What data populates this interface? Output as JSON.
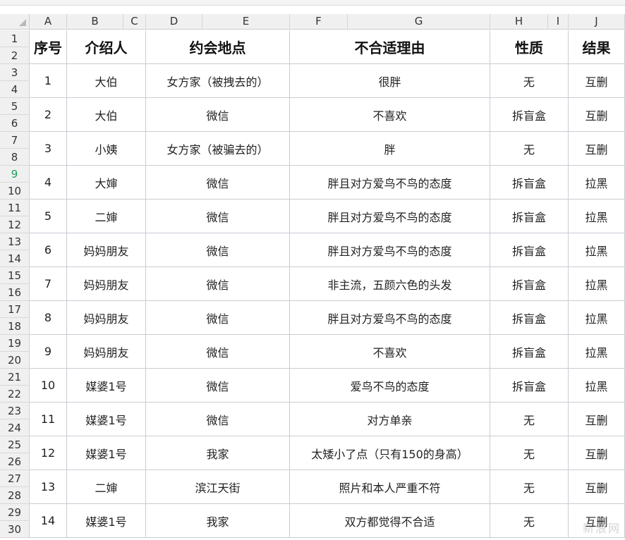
{
  "column_letters": [
    "A",
    "B",
    "C",
    "D",
    "E",
    "F",
    "G",
    "H",
    "I",
    "J"
  ],
  "row_numbers": [
    "1",
    "2",
    "3",
    "4",
    "5",
    "6",
    "7",
    "8",
    "9",
    "10",
    "11",
    "12",
    "13",
    "14",
    "15",
    "16",
    "17",
    "18",
    "19",
    "20",
    "21",
    "22",
    "23",
    "24",
    "25",
    "26",
    "27",
    "28",
    "29",
    "30"
  ],
  "selected_row": "9",
  "accent_color": "#1e9e5a",
  "headers": {
    "no": "序号",
    "introducer": "介绍人",
    "location": "约会地点",
    "reason": "不合适理由",
    "nature": "性质",
    "result": "结果"
  },
  "records": [
    {
      "no": "1",
      "introducer": "大伯",
      "location": "女方家（被拽去的）",
      "reason": "很胖",
      "nature": "无",
      "result": "互删"
    },
    {
      "no": "2",
      "introducer": "大伯",
      "location": "微信",
      "reason": "不喜欢",
      "nature": "拆盲盒",
      "result": "互删"
    },
    {
      "no": "3",
      "introducer": "小姨",
      "location": "女方家（被骗去的）",
      "reason": "胖",
      "nature": "无",
      "result": "互删"
    },
    {
      "no": "4",
      "introducer": "大婶",
      "location": "微信",
      "reason": "胖且对方爱鸟不鸟的态度",
      "nature": "拆盲盒",
      "result": "拉黑"
    },
    {
      "no": "5",
      "introducer": "二婶",
      "location": "微信",
      "reason": "胖且对方爱鸟不鸟的态度",
      "nature": "拆盲盒",
      "result": "拉黑"
    },
    {
      "no": "6",
      "introducer": "妈妈朋友",
      "location": "微信",
      "reason": "胖且对方爱鸟不鸟的态度",
      "nature": "拆盲盒",
      "result": "拉黑"
    },
    {
      "no": "7",
      "introducer": "妈妈朋友",
      "location": "微信",
      "reason": "非主流，五颜六色的头发",
      "nature": "拆盲盒",
      "result": "拉黑"
    },
    {
      "no": "8",
      "introducer": "妈妈朋友",
      "location": "微信",
      "reason": "胖且对方爱鸟不鸟的态度",
      "nature": "拆盲盒",
      "result": "拉黑"
    },
    {
      "no": "9",
      "introducer": "妈妈朋友",
      "location": "微信",
      "reason": "不喜欢",
      "nature": "拆盲盒",
      "result": "拉黑"
    },
    {
      "no": "10",
      "introducer": "媒婆1号",
      "location": "微信",
      "reason": "爱鸟不鸟的态度",
      "nature": "拆盲盒",
      "result": "拉黑"
    },
    {
      "no": "11",
      "introducer": "媒婆1号",
      "location": "微信",
      "reason": "对方单亲",
      "nature": "无",
      "result": "互删"
    },
    {
      "no": "12",
      "introducer": "媒婆1号",
      "location": "我家",
      "reason": "太矮小了点（只有150的身高）",
      "nature": "无",
      "result": "互删"
    },
    {
      "no": "13",
      "introducer": "二婶",
      "location": "滨江天街",
      "reason": "照片和本人严重不符",
      "nature": "无",
      "result": "互删"
    },
    {
      "no": "14",
      "introducer": "媒婆1号",
      "location": "我家",
      "reason": "双方都觉得不合适",
      "nature": "无",
      "result": "互删"
    }
  ],
  "watermark": "新浪网"
}
